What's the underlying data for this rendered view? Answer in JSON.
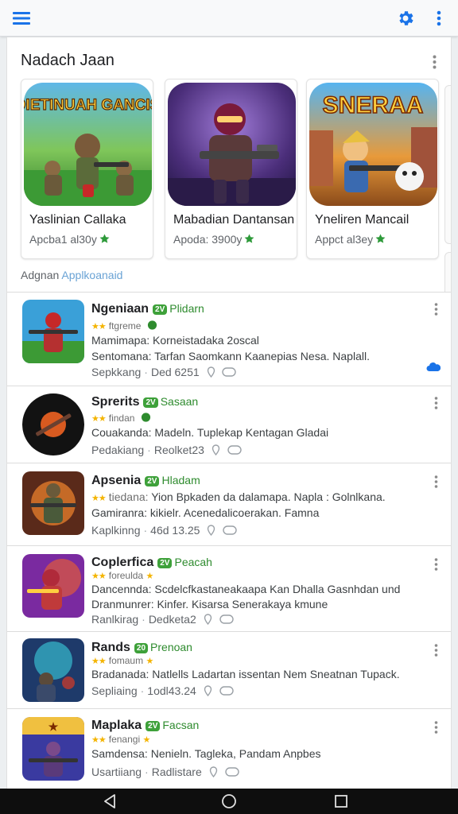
{
  "topbar": {
    "menu_icon": "hamburger-icon",
    "settings_icon": "gear-icon",
    "overflow_icon": "vertical-dots-icon",
    "accent": "#1a73e8"
  },
  "section": {
    "title": "Nadach Jaan",
    "sub_prefix": "Adgnan",
    "sub_link": "Applkoanaid"
  },
  "cards": [
    {
      "art_text": "DIETINUAH GANCIS",
      "name": "Yaslinian Callaka",
      "meta": "Apcba1 al30y"
    },
    {
      "art_text": "",
      "name": "Mabadian Dantansan",
      "meta": "Apoda: 3900y"
    },
    {
      "art_text": "SNERAA",
      "name": "Yneliren Mancail",
      "meta": "Appct al3ey"
    }
  ],
  "apps": [
    {
      "title": "Ngeniaan",
      "tag_pill": "2V",
      "tag": "Plidarn",
      "sub": "ftgreme",
      "line1": "Mamimapa: Korneistadaka 2oscal",
      "line2": "Sentomana: Tarfan Saomkann Kaanepias Nesa. Naplall.",
      "foot_label": "Sepkkang",
      "foot_value": "Ded 6251"
    },
    {
      "title": "Sprerits",
      "tag_pill": "2V",
      "tag": "Sasaan",
      "sub": "findan",
      "line1": "Couakanda: Madeln. Tuplekap Kentagan Gladai",
      "line2": "",
      "foot_label": "Pedakiang",
      "foot_value": "Reolket23"
    },
    {
      "title": "Apsenia",
      "tag_pill": "2V",
      "tag": "Hladam",
      "sub": "tiedana:",
      "line1": "Yion Bpkaden da dalamapa. Napla : Golnlkana.",
      "line2": "Gamiranra: kikielr. Acenedalicoerakan. Famna",
      "foot_label": "Kaplkinng",
      "foot_value": "46d 13.25"
    },
    {
      "title": "Coplerfica",
      "tag_pill": "2V",
      "tag": "Peacah",
      "sub": "foreulda",
      "line1": "Dancennda: Scdelcfkastaneakaapa Kan Dhalla Gasnhdan und",
      "line2": "Dranmunrer: Kinfer. Kisarsa Senerakaya kmune",
      "foot_label": "Ranlkirag",
      "foot_value": "Dedketa2"
    },
    {
      "title": "Rands",
      "tag_pill": "20",
      "tag": "Prenoan",
      "sub": "fomaum",
      "line1": "Bradanada: Natlells Ladartan issentan Nem Sneatnan Tupack.",
      "line2": "",
      "foot_label": "Sepliaing",
      "foot_value": "1odl43.24"
    },
    {
      "title": "Maplaka",
      "tag_pill": "2V",
      "tag": "Facsan",
      "sub": "fenangi",
      "line1": "Samdensa: Nenieln. Tagleka, Pandam Anpbes",
      "line2": "",
      "foot_label": "Usartiiang",
      "foot_value": "Radlistare"
    }
  ],
  "navbar": {
    "back_icon": "back-triangle-icon",
    "home_icon": "home-circle-icon",
    "recents_icon": "recents-square-icon"
  }
}
